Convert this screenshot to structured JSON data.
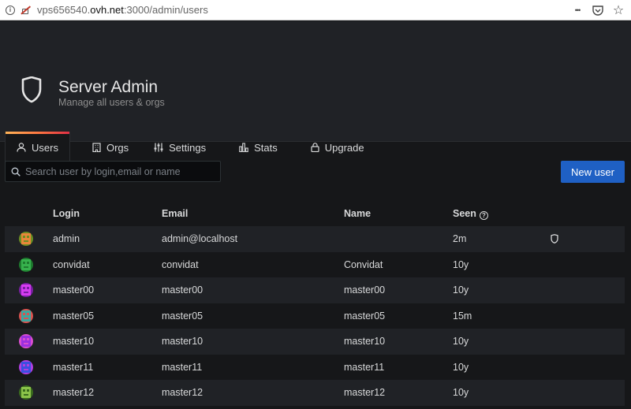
{
  "browser": {
    "url_prefix": "vps656540.",
    "url_host": "ovh.net",
    "url_path": ":3000/admin/users",
    "more": "•••",
    "pocket": "♡",
    "star": "☆"
  },
  "header": {
    "title": "Server Admin",
    "subtitle": "Manage all users & orgs"
  },
  "tabs": [
    {
      "label": "Users",
      "icon": "user-icon",
      "active": true
    },
    {
      "label": "Orgs",
      "icon": "building-icon",
      "active": false
    },
    {
      "label": "Settings",
      "icon": "sliders-icon",
      "active": false
    },
    {
      "label": "Stats",
      "icon": "bar-chart-icon",
      "active": false
    },
    {
      "label": "Upgrade",
      "icon": "lock-icon",
      "active": false
    }
  ],
  "search": {
    "placeholder": "Search user by login,email or name"
  },
  "new_user_label": "New user",
  "table": {
    "columns": {
      "login": "Login",
      "email": "Email",
      "name": "Name",
      "seen": "Seen",
      "seen_info": "?"
    },
    "rows": [
      {
        "login": "admin",
        "email": "admin@localhost",
        "name": "",
        "seen": "2m",
        "is_admin": true,
        "avatar_color": "#e8873a",
        "avatar_accent": "#6b8e23"
      },
      {
        "login": "convidat",
        "email": "convidat",
        "name": "Convidat",
        "seen": "10y",
        "is_admin": false,
        "avatar_color": "#37b24d",
        "avatar_accent": "#1e7a2e"
      },
      {
        "login": "master00",
        "email": "master00",
        "name": "master00",
        "seen": "10y",
        "is_admin": false,
        "avatar_color": "#d63cf0",
        "avatar_accent": "#7a1fa3"
      },
      {
        "login": "master05",
        "email": "master05",
        "name": "master05",
        "seen": "15m",
        "is_admin": false,
        "avatar_color": "#3ba7a0",
        "avatar_accent": "#d9534f"
      },
      {
        "login": "master10",
        "email": "master10",
        "name": "master10",
        "seen": "10y",
        "is_admin": false,
        "avatar_color": "#9b30e0",
        "avatar_accent": "#d94fd0"
      },
      {
        "login": "master11",
        "email": "master11",
        "name": "master11",
        "seen": "10y",
        "is_admin": false,
        "avatar_color": "#3b4fe0",
        "avatar_accent": "#b03fe0"
      },
      {
        "login": "master12",
        "email": "master12",
        "name": "master12",
        "seen": "10y",
        "is_admin": false,
        "avatar_color": "#8bc34a",
        "avatar_accent": "#3a6b1e"
      }
    ]
  },
  "colors": {
    "accent": "#1f60c4",
    "background": "#161719",
    "panel": "#202226"
  }
}
